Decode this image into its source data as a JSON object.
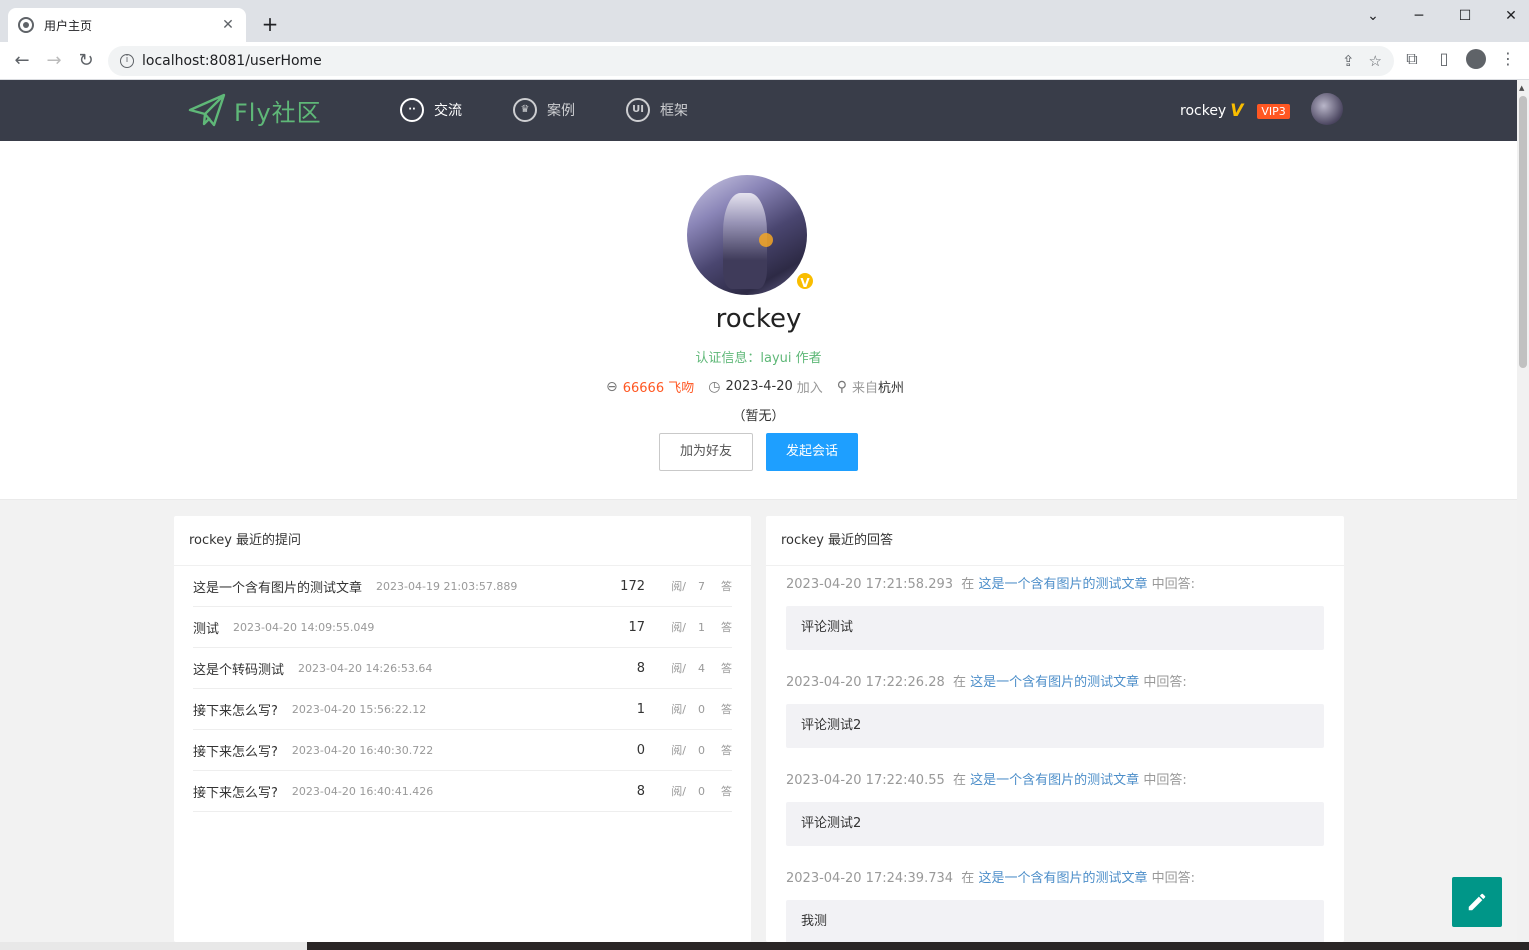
{
  "browser": {
    "tab_title": "用户主页",
    "tab_close": "✕",
    "new_tab": "+",
    "url": "localhost:8081/userHome",
    "win_minimize": "─",
    "win_maximize": "☐",
    "win_close": "✕",
    "win_dropdown": "⌄"
  },
  "header": {
    "logo_text": "Fly社区",
    "nav": [
      {
        "label": "交流",
        "icon": "chat-icon"
      },
      {
        "label": "案例",
        "icon": "crown-icon"
      },
      {
        "label": "框架",
        "icon": "ui-icon"
      }
    ],
    "username": "rockey",
    "v_mark": "V",
    "vip": "VIP3"
  },
  "profile": {
    "name": "rockey",
    "cert": "认证信息：layui 作者",
    "kiss": "66666 飞吻",
    "join_date": "2023-4-20",
    "join_label": "加入",
    "city_prefix": "来自",
    "city": "杭州",
    "sign": "（暂无）",
    "add_friend": "加为好友",
    "start_chat": "发起会话",
    "avatar_badge": "V"
  },
  "questions": {
    "title": "rockey 最近的提问",
    "read_label": "阅/",
    "answer_label": "答",
    "rows": [
      {
        "title": "这是一个含有图片的测试文章",
        "time": "2023-04-19 21:03:57.889",
        "views": "172",
        "answers": "7"
      },
      {
        "title": "测试",
        "time": "2023-04-20 14:09:55.049",
        "views": "17",
        "answers": "1"
      },
      {
        "title": "这是个转码测试",
        "time": "2023-04-20 14:26:53.64",
        "views": "8",
        "answers": "4"
      },
      {
        "title": "接下来怎么写?",
        "time": "2023-04-20 15:56:22.12",
        "views": "1",
        "answers": "0"
      },
      {
        "title": "接下来怎么写?",
        "time": "2023-04-20 16:40:30.722",
        "views": "0",
        "answers": "0"
      },
      {
        "title": "接下来怎么写?",
        "time": "2023-04-20 16:40:41.426",
        "views": "8",
        "answers": "0"
      }
    ]
  },
  "answers": {
    "title": "rockey 最近的回答",
    "in_label": "在",
    "suffix": "中回答:",
    "items": [
      {
        "time": "2023-04-20 17:21:58.293",
        "article": "这是一个含有图片的测试文章",
        "content": "评论测试"
      },
      {
        "time": "2023-04-20 17:22:26.28",
        "article": "这是一个含有图片的测试文章",
        "content": "评论测试2"
      },
      {
        "time": "2023-04-20 17:22:40.55",
        "article": "这是一个含有图片的测试文章",
        "content": "评论测试2"
      },
      {
        "time": "2023-04-20 17:24:39.734",
        "article": "这是一个含有图片的测试文章",
        "content": "我测"
      }
    ]
  },
  "colors": {
    "header_bg": "#393d49",
    "brand_green": "#5fb878",
    "primary_blue": "#1e9fff",
    "vip_orange": "#ff5722",
    "fab_teal": "#009688",
    "v_gold": "#f9bd00"
  }
}
